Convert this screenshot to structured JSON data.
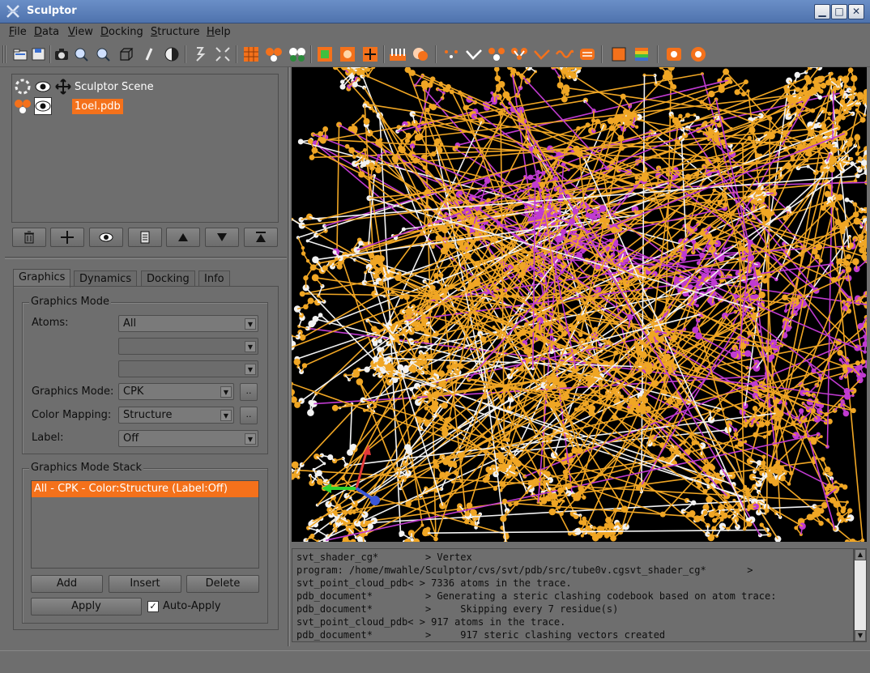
{
  "window": {
    "title": "Sculptor",
    "minimize_glyph": "▁",
    "maximize_glyph": "□",
    "close_glyph": "✕",
    "accent_color": "#f4711b"
  },
  "menu": {
    "file": "File",
    "data": "Data",
    "view": "View",
    "docking": "Docking",
    "structure": "Structure",
    "help": "Help"
  },
  "toolbar": {
    "icons": [
      "open-icon",
      "save-icon",
      "screenshot-icon",
      "zoom-in-icon",
      "zoom-out-icon",
      "box-icon",
      "clip-icon",
      "contrast-icon",
      "sharpen-icon",
      "expand-icon",
      "grid-icon",
      "molecule-icon",
      "molecules-icon",
      "voxel-icon",
      "voxel2-icon",
      "move-icon",
      "bar-icon",
      "sphere-icon",
      "dots-icon",
      "check-icon",
      "atoms-icon",
      "atoms2-icon",
      "check2-icon",
      "wave-icon",
      "swap-icon",
      "square-icon",
      "stripes-icon",
      "gear-icon",
      "circle-gear-icon"
    ]
  },
  "scene": {
    "root_label": "Sculptor Scene",
    "item_label": "1oel.pdb"
  },
  "tabs": {
    "graphics": "Graphics",
    "dynamics": "Dynamics",
    "docking": "Docking",
    "info": "Info"
  },
  "graphics_mode": {
    "group_title": "Graphics Mode",
    "atoms_label": "Atoms:",
    "atoms_value": "All",
    "graphics_mode_label": "Graphics Mode:",
    "graphics_mode_value": "CPK",
    "color_mapping_label": "Color Mapping:",
    "color_mapping_value": "Structure",
    "label_label": "Label:",
    "label_value": "Off",
    "more_button": ".."
  },
  "stack": {
    "group_title": "Graphics Mode Stack",
    "items": [
      "All - CPK - Color:Structure (Label:Off)"
    ],
    "add": "Add",
    "insert": "Insert",
    "delete": "Delete",
    "apply": "Apply",
    "auto_apply": "Auto-Apply",
    "auto_apply_mark": "✓"
  },
  "console": {
    "lines": [
      "svt_shader_cg*        > Vertex",
      "program: /home/mwahle/Sculptor/cvs/svt/pdb/src/tube0v.cgsvt_shader_cg*       >",
      "svt_point_cloud_pdb< > 7336 atoms in the trace.",
      "pdb_document*         > Generating a steric clashing codebook based on atom trace:",
      "pdb_document*         >     Skipping every 7 residue(s)",
      "svt_point_cloud_pdb< > 917 atoms in the trace.",
      "pdb_document*         >     917 steric clashing vectors created"
    ]
  },
  "viewport": {
    "colors": {
      "background": "#000000",
      "orange": "#f0a624",
      "magenta": "#c13bd1",
      "white": "#f2f2f2"
    }
  }
}
